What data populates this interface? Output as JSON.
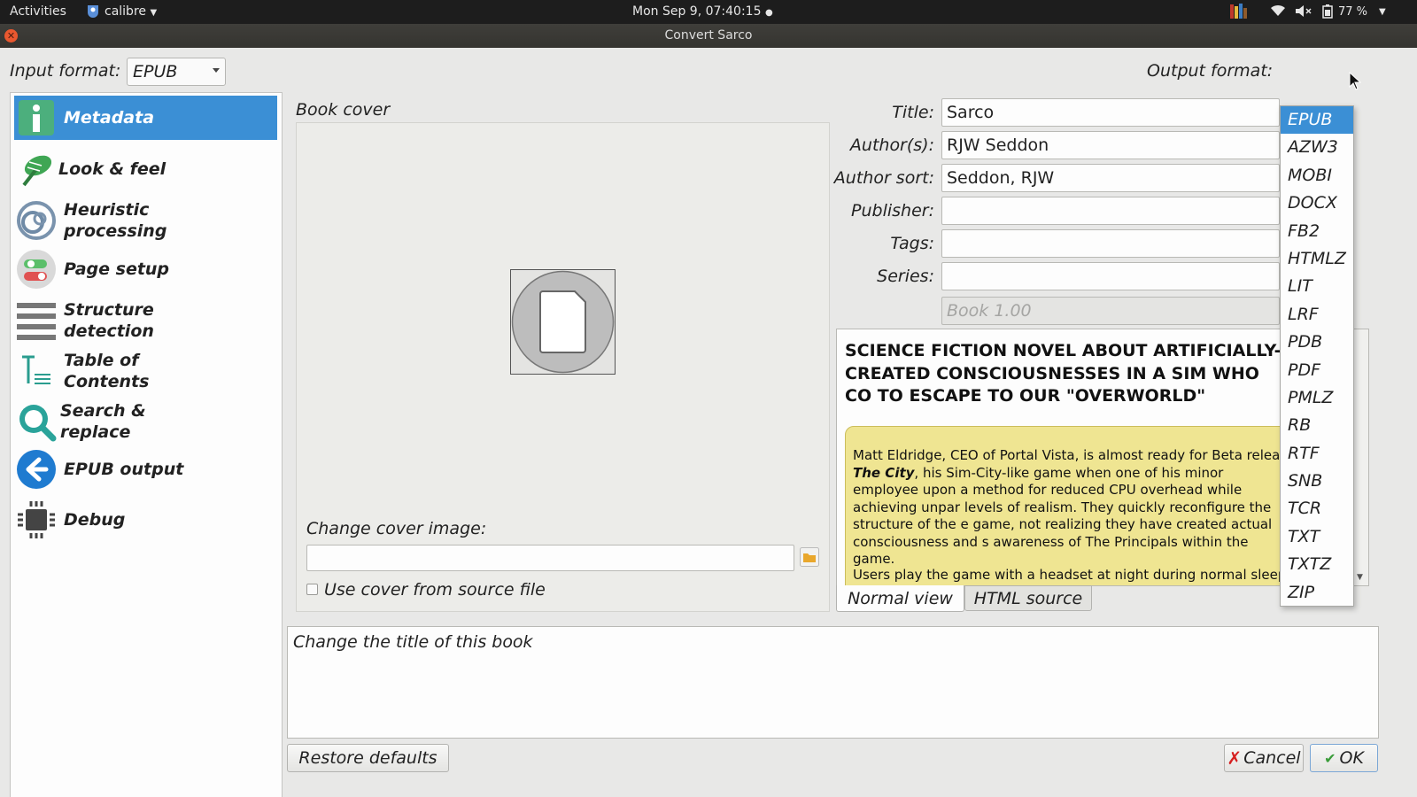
{
  "topbar": {
    "activities": "Activities",
    "app_name": "calibre",
    "clock": "Mon Sep  9, 07:40:15",
    "battery": "77 %"
  },
  "window": {
    "title": "Convert Sarco"
  },
  "input_format": {
    "label": "Input format:",
    "value": "EPUB"
  },
  "output_format": {
    "label": "Output format:",
    "selected": "EPUB",
    "options": [
      "EPUB",
      "AZW3",
      "MOBI",
      "DOCX",
      "FB2",
      "HTMLZ",
      "LIT",
      "LRF",
      "PDB",
      "PDF",
      "PMLZ",
      "RB",
      "RTF",
      "SNB",
      "TCR",
      "TXT",
      "TXTZ",
      "ZIP"
    ]
  },
  "sidebar": {
    "items": [
      {
        "label": "Metadata",
        "icon": "info-icon"
      },
      {
        "label": "Look & feel",
        "icon": "brush-icon"
      },
      {
        "label": "Heuristic processing",
        "icon": "spiral-icon"
      },
      {
        "label": "Page setup",
        "icon": "toggle-icon"
      },
      {
        "label": "Structure detection",
        "icon": "lines-icon"
      },
      {
        "label": "Table of Contents",
        "icon": "toc-icon"
      },
      {
        "label": "Search & replace",
        "icon": "search-icon"
      },
      {
        "label": "EPUB output",
        "icon": "back-arrow-icon"
      },
      {
        "label": "Debug",
        "icon": "chip-icon"
      }
    ]
  },
  "cover": {
    "heading": "Book cover",
    "change_label": "Change cover image:",
    "path_value": "",
    "use_source_label": "Use cover from source file"
  },
  "meta": {
    "title_label": "Title:",
    "title_value": "Sarco",
    "authors_label": "Author(s):",
    "authors_value": "RJW Seddon",
    "author_sort_label": "Author sort:",
    "author_sort_value": "Seddon, RJW",
    "publisher_label": "Publisher:",
    "publisher_value": "",
    "tags_label": "Tags:",
    "tags_value": "",
    "series_label": "Series:",
    "series_value": "",
    "series_index": "Book 1.00"
  },
  "comments": {
    "heading": "SCIENCE FICTION NOVEL ABOUT ARTIFICIALLY-CREATED CONSCIOUSNESSES IN A SIM WHO CO TO ESCAPE TO OUR \"OVERWORLD\"",
    "p1_a": "Matt Eldridge, CEO of Portal Vista, is almost ready for Beta relea",
    "p1_em": "The City",
    "p1_b": ", his Sim-City-like game when one of his minor employee upon a method for reduced CPU overhead while achieving unpar levels of realism. They quickly reconfigure the structure of the e game, not realizing they have created actual consciousness and s awareness of The Principals within the game.",
    "p2": "Users play the game with a headset at night during normal sleep hours",
    "tab_normal": "Normal view",
    "tab_html": "HTML source"
  },
  "help_text": "Change the title of this book",
  "buttons": {
    "restore": "Restore defaults",
    "cancel": "Cancel",
    "ok": "OK"
  },
  "colors": {
    "accent": "#3b8fd5",
    "comment_bg": "#efe592"
  }
}
